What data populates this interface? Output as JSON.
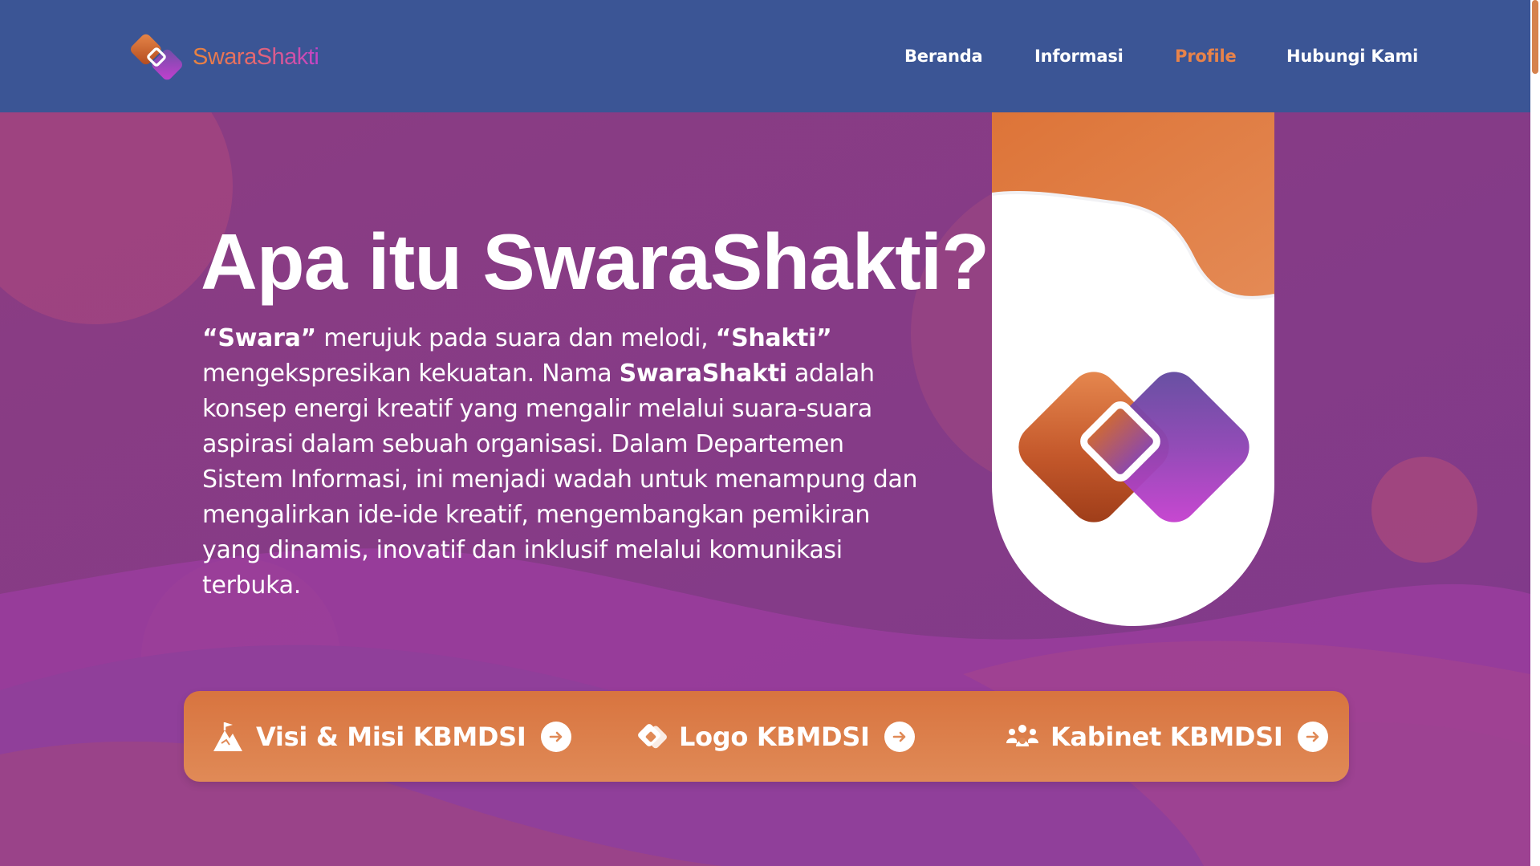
{
  "brand": {
    "name": "SwaraShakti",
    "colors": {
      "orange": "#e8834a",
      "purple": "#b63ec0",
      "navy": "#3b5595",
      "background": "#893d84"
    }
  },
  "nav": {
    "items": [
      {
        "label": "Beranda",
        "active": false
      },
      {
        "label": "Informasi",
        "active": false
      },
      {
        "label": "Profile",
        "active": true
      },
      {
        "label": "Hubungi Kami",
        "active": false
      }
    ]
  },
  "hero": {
    "title": "Apa itu SwaraShakti?",
    "desc": {
      "q1": "“Swara”",
      "t1": " merujuk pada suara dan melodi, ",
      "q2": "“Shakti”",
      "t2": " mengekspresikan kekuatan. Nama ",
      "brand": "SwaraShakti",
      "t3": " adalah konsep energi kreatif yang mengalir melalui suara-suara aspirasi dalam sebuah organisasi. Dalam Departemen Sistem Informasi, ini menjadi wadah untuk menampung dan mengalirkan ide-ide kreatif, mengembangkan pemikiran yang dinamis, inovatif dan inklusif melalui komunikasi terbuka."
    }
  },
  "links": [
    {
      "label": "Visi & Misi KBMDSI",
      "icon": "mountain-flag-icon"
    },
    {
      "label": "Logo KBMDSI",
      "icon": "diamond-logo-icon"
    },
    {
      "label": "Kabinet KBMDSI",
      "icon": "team-icon"
    }
  ]
}
